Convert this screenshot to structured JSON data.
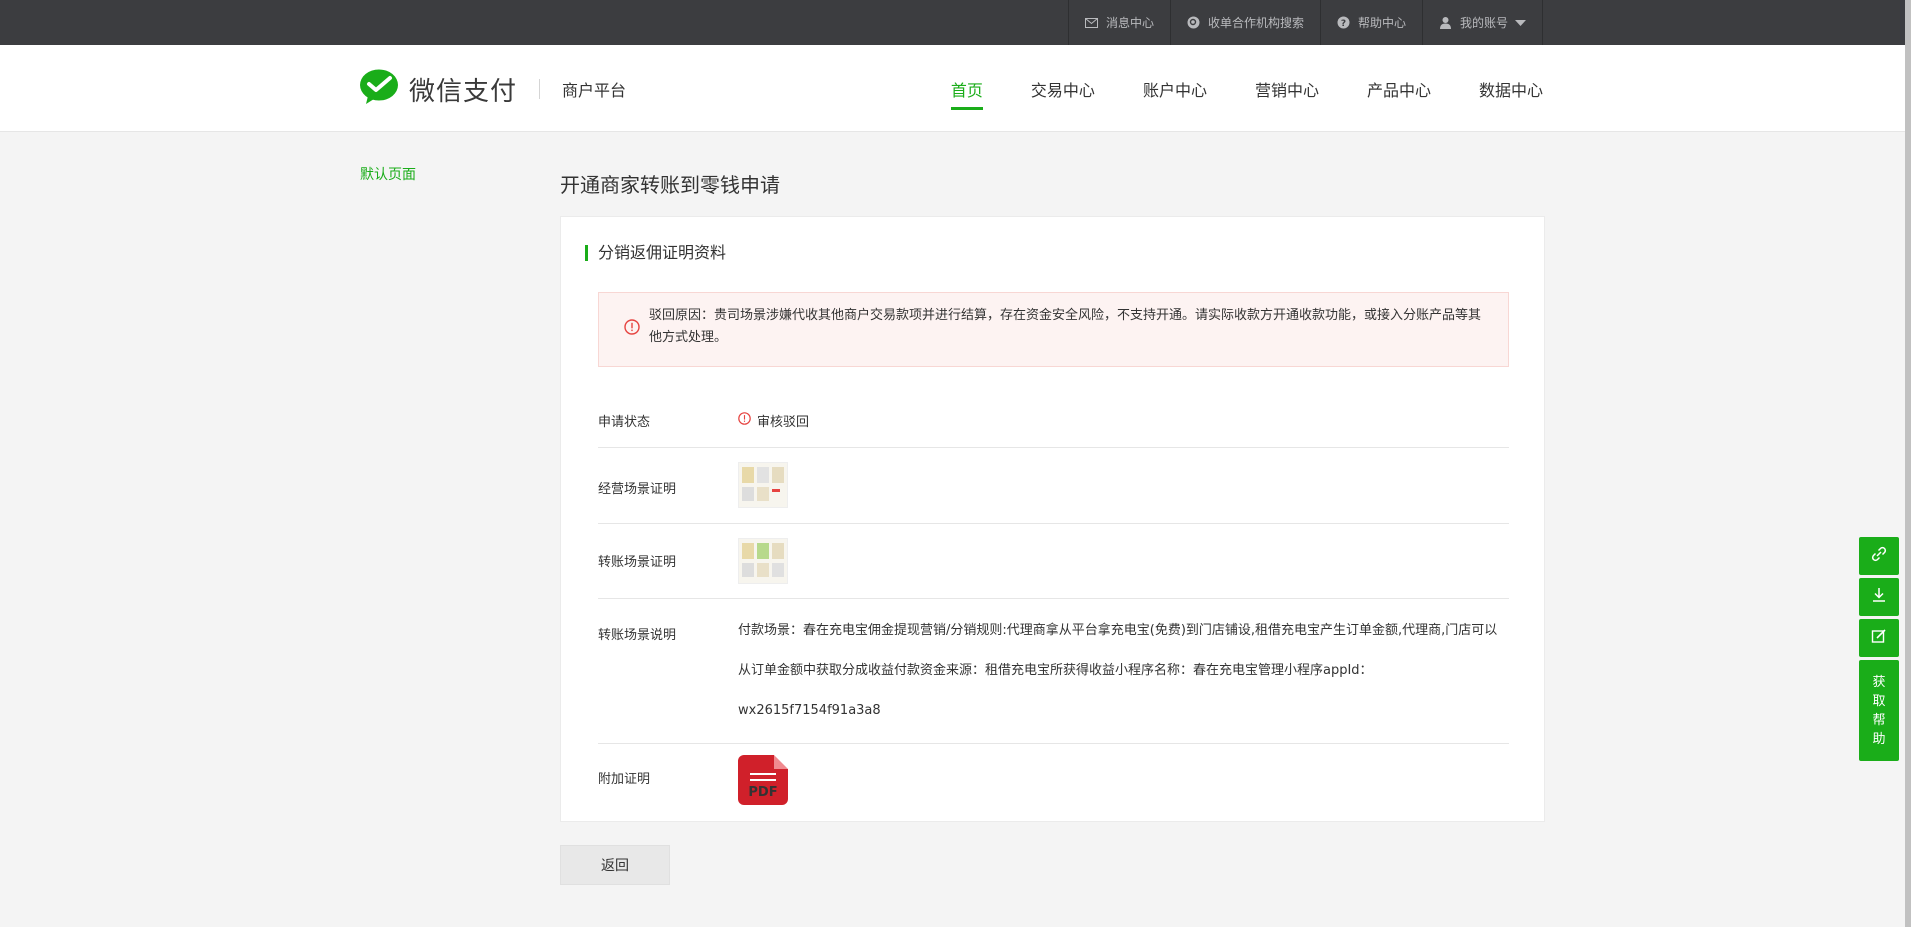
{
  "topbar": {
    "links": [
      {
        "label": "消息中心",
        "icon": "mail-icon"
      },
      {
        "label": "收单合作机构搜索",
        "icon": "search-circle-icon"
      },
      {
        "label": "帮助中心",
        "icon": "help-circle-icon"
      },
      {
        "label": "我的账号",
        "icon": "user-icon"
      }
    ]
  },
  "header": {
    "brand": "微信支付",
    "subtitle": "商户平台",
    "nav": [
      "首页",
      "交易中心",
      "账户中心",
      "营销中心",
      "产品中心",
      "数据中心"
    ],
    "active_nav": "首页"
  },
  "sidebar": {
    "link": "默认页面"
  },
  "page": {
    "title": "开通商家转账到零钱申请",
    "section_title": "分销返佣证明资料",
    "alert": "驳回原因：贵司场景涉嫌代收其他商户交易款项并进行结算，存在资金安全风险，不支持开通。请实际收款方开通收款功能，或接入分账产品等其他方式处理。",
    "rows": {
      "status_label": "申请状态",
      "status_value": "审核驳回",
      "scene_proof_label": "经营场景证明",
      "transfer_proof_label": "转账场景证明",
      "transfer_desc_label": "转账场景说明",
      "transfer_desc_value": "付款场景：春在充电宝佣金提现营销/分销规则:代理商拿从平台拿充电宝(免费)到门店铺设,租借充电宝产生订单金额,代理商,门店可以从订单金额中获取分成收益付款资金来源：租借充电宝所获得收益小程序名称：春在充电宝管理小程序appId：wx2615f7154f91a3a8",
      "attach_label": "附加证明",
      "pdf_text": "PDF"
    },
    "back_button": "返回"
  },
  "float_tools": {
    "icons": [
      "link-icon",
      "download-icon",
      "edit-icon"
    ],
    "help_chars": [
      "获",
      "取",
      "帮",
      "助"
    ]
  },
  "colors": {
    "accent": "#1aad19",
    "error": "#e64340",
    "topbar": "#3c3d40"
  }
}
